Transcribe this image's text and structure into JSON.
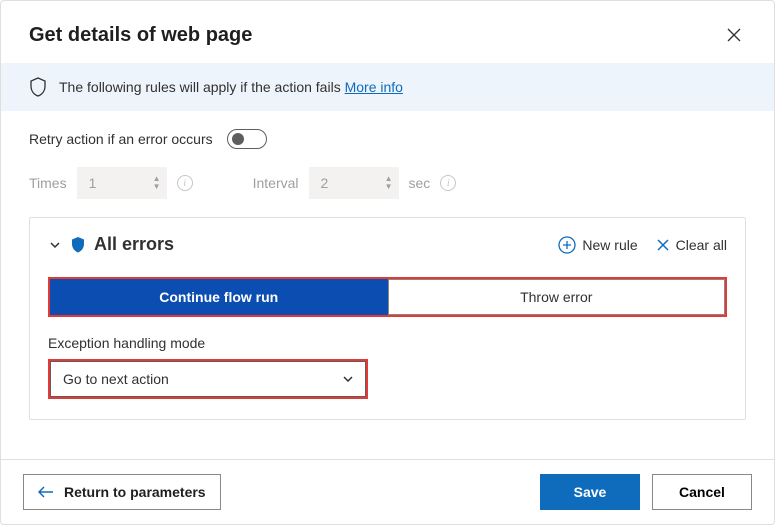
{
  "dialog": {
    "title": "Get details of web page"
  },
  "notice": {
    "text": "The following rules will apply if the action fails",
    "link": "More info"
  },
  "retry": {
    "label": "Retry action if an error occurs",
    "enabled": false,
    "times_label": "Times",
    "times_value": "1",
    "interval_label": "Interval",
    "interval_value": "2",
    "seconds_label": "sec"
  },
  "errors": {
    "title": "All errors",
    "new_rule": "New rule",
    "clear_all": "Clear all",
    "segments": {
      "continue": "Continue flow run",
      "throw": "Throw error"
    },
    "handling_label": "Exception handling mode",
    "handling_value": "Go to next action"
  },
  "footer": {
    "return": "Return to parameters",
    "save": "Save",
    "cancel": "Cancel"
  },
  "colors": {
    "accent": "#0f6cbd",
    "highlight": "#e53935"
  }
}
